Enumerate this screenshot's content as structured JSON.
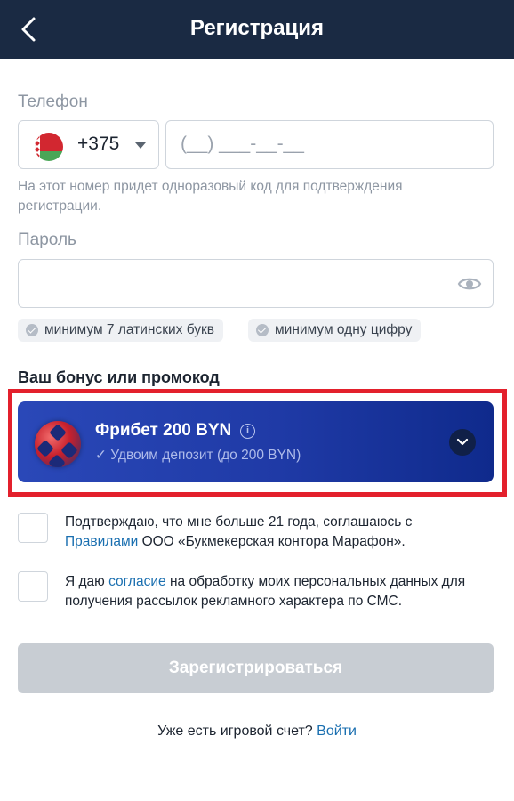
{
  "header": {
    "title": "Регистрация"
  },
  "phone": {
    "label": "Телефон",
    "country_code": "+375",
    "placeholder": "(__) ___-__-__",
    "hint": "На этот номер придет одноразовый код для подтверждения регистрации."
  },
  "password": {
    "label": "Пароль",
    "rules": [
      "минимум 7 латинских букв",
      "минимум одну цифру"
    ]
  },
  "bonus": {
    "section_title": "Ваш бонус или промокод",
    "name": "Фрибет 200 BYN",
    "subtitle": "✓ Удвоим депозит (до 200 BYN)"
  },
  "consents": {
    "age_prefix": "Подтверждаю, что мне больше 21 года, соглашаюсь с ",
    "age_link": "Правилами",
    "age_suffix": " ООО «Букмекерская контора Марафон».",
    "data_prefix": "Я даю ",
    "data_link": "согласие",
    "data_suffix": " на обработку моих персональных данных для получения рассылок рекламного характера по СМС."
  },
  "submit_label": "Зарегистрироваться",
  "login": {
    "prompt": "Уже есть игровой счет? ",
    "link": "Войти"
  },
  "colors": {
    "header": "#1a2a43",
    "highlight": "#e3202c",
    "link": "#1a6fb0",
    "bonus_card": "#1f3aa6"
  },
  "icons": {
    "back": "chevron-left-icon",
    "flag": "belarus-flag-icon",
    "eye": "eye-icon",
    "info": "info-icon",
    "expand": "chevron-down-icon"
  }
}
